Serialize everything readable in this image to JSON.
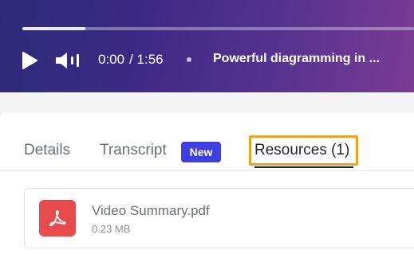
{
  "player": {
    "progress_fraction": 0.16,
    "current_time": "0:00",
    "duration": "/ 1:56",
    "title": "Powerful diagramming in ...",
    "icons": {
      "play": "play-icon",
      "volume": "volume-icon"
    }
  },
  "tabs": {
    "details": "Details",
    "transcript": "Transcript",
    "transcript_badge": "New",
    "resources": "Resources (1)"
  },
  "resources": {
    "items": [
      {
        "name": "Video Summary.pdf",
        "size": "0.23 MB",
        "icon": "pdf-icon"
      }
    ]
  },
  "colors": {
    "accent_badge": "#3f3fe0",
    "highlight_border": "#f0a020",
    "pdf_icon_bg": "#e84b4b"
  }
}
